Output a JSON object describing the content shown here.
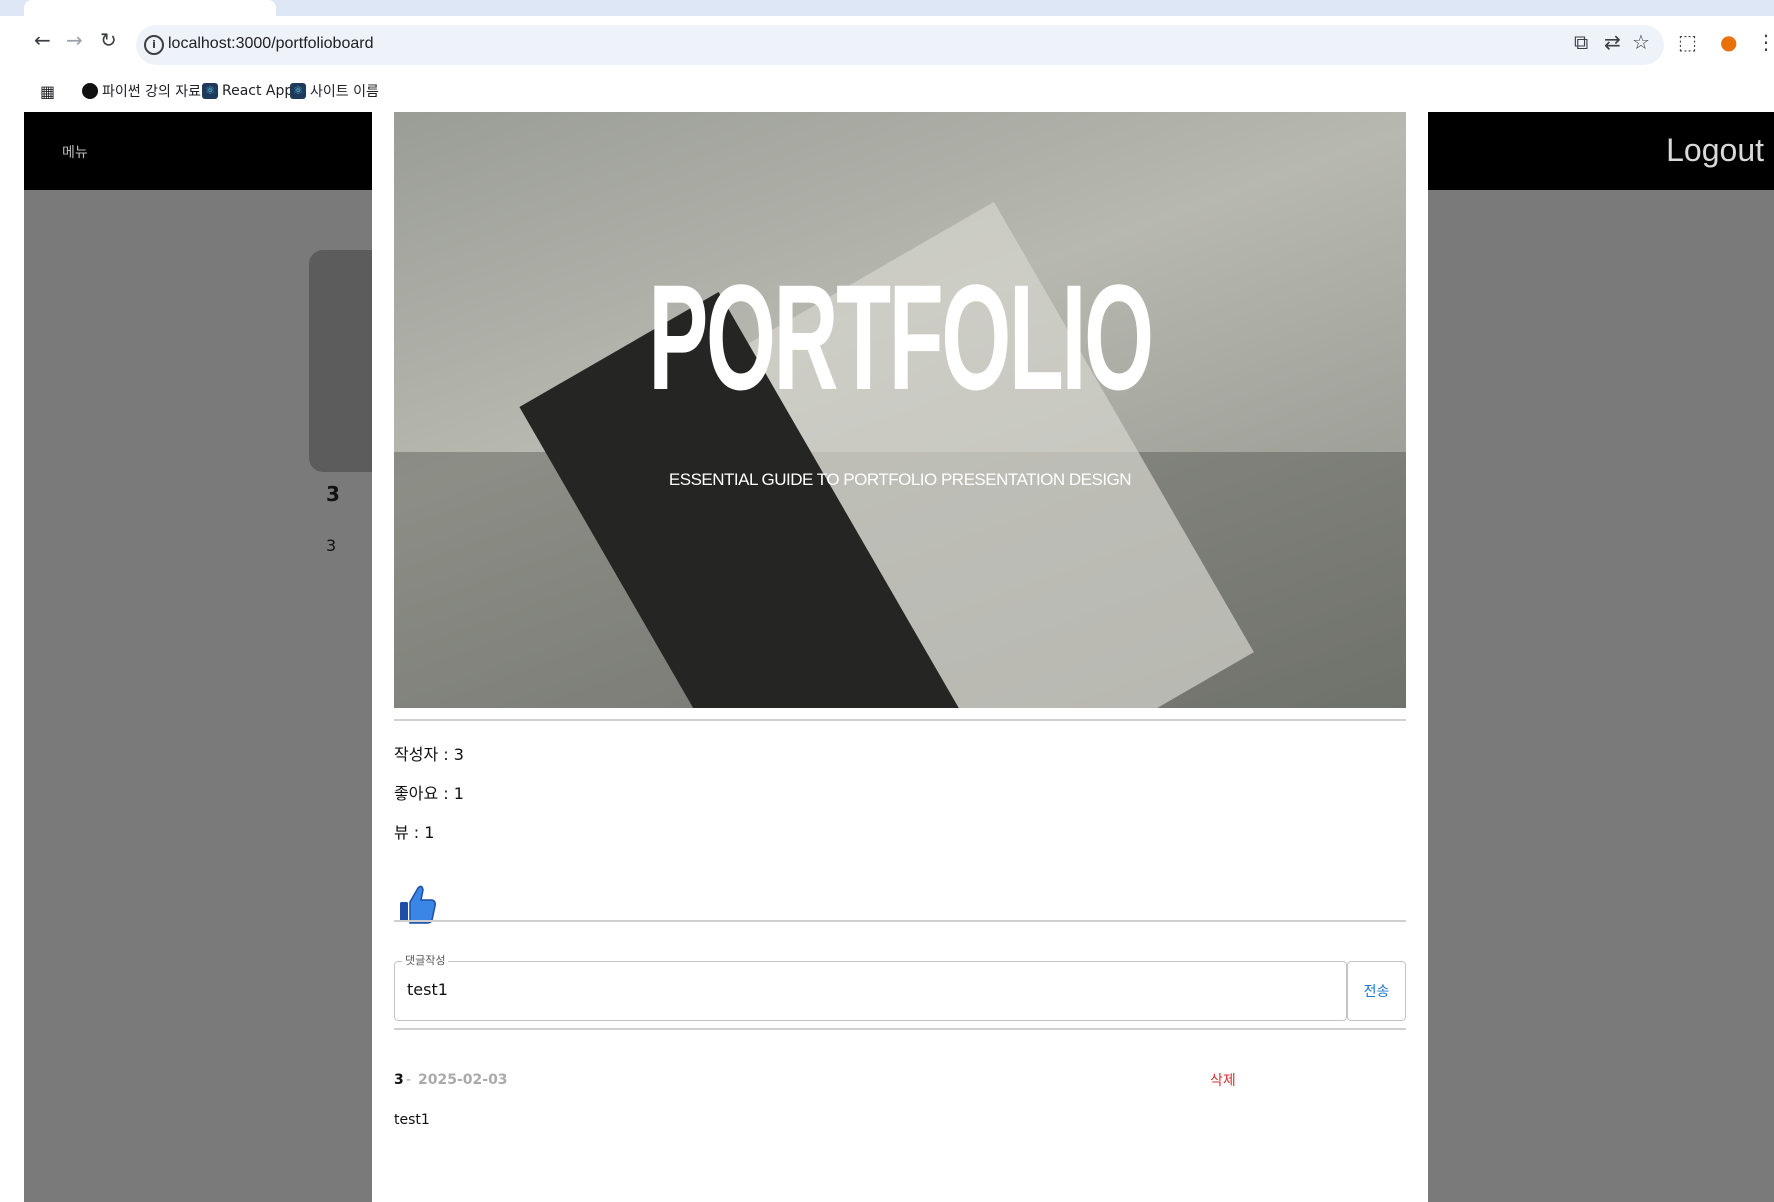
{
  "browser": {
    "url": "localhost:3000/portfolioboard",
    "bookmarks": [
      {
        "label": "파이썬 강의 자료"
      },
      {
        "label": "React App"
      },
      {
        "label": "사이트 이름"
      }
    ]
  },
  "navbar": {
    "menu_label": "메뉴",
    "logout_label": "Logout"
  },
  "background_card": {
    "title": "3",
    "subtitle": "3"
  },
  "modal": {
    "hero": {
      "title": "PORTFOLIO",
      "subtitle": "ESSENTIAL GUIDE TO PORTFOLIO PRESENTATION DESIGN"
    },
    "author_line": "작성자 : 3",
    "likes_line": "좋아요 : 1",
    "views_line": "뷰 : 1",
    "comment_form": {
      "legend": "댓글작성",
      "value": "test1",
      "send_label": "전송"
    },
    "comments": [
      {
        "author": "3",
        "separator": "-",
        "date": "2025-02-03",
        "delete_label": "삭제",
        "body": "test1"
      }
    ]
  }
}
